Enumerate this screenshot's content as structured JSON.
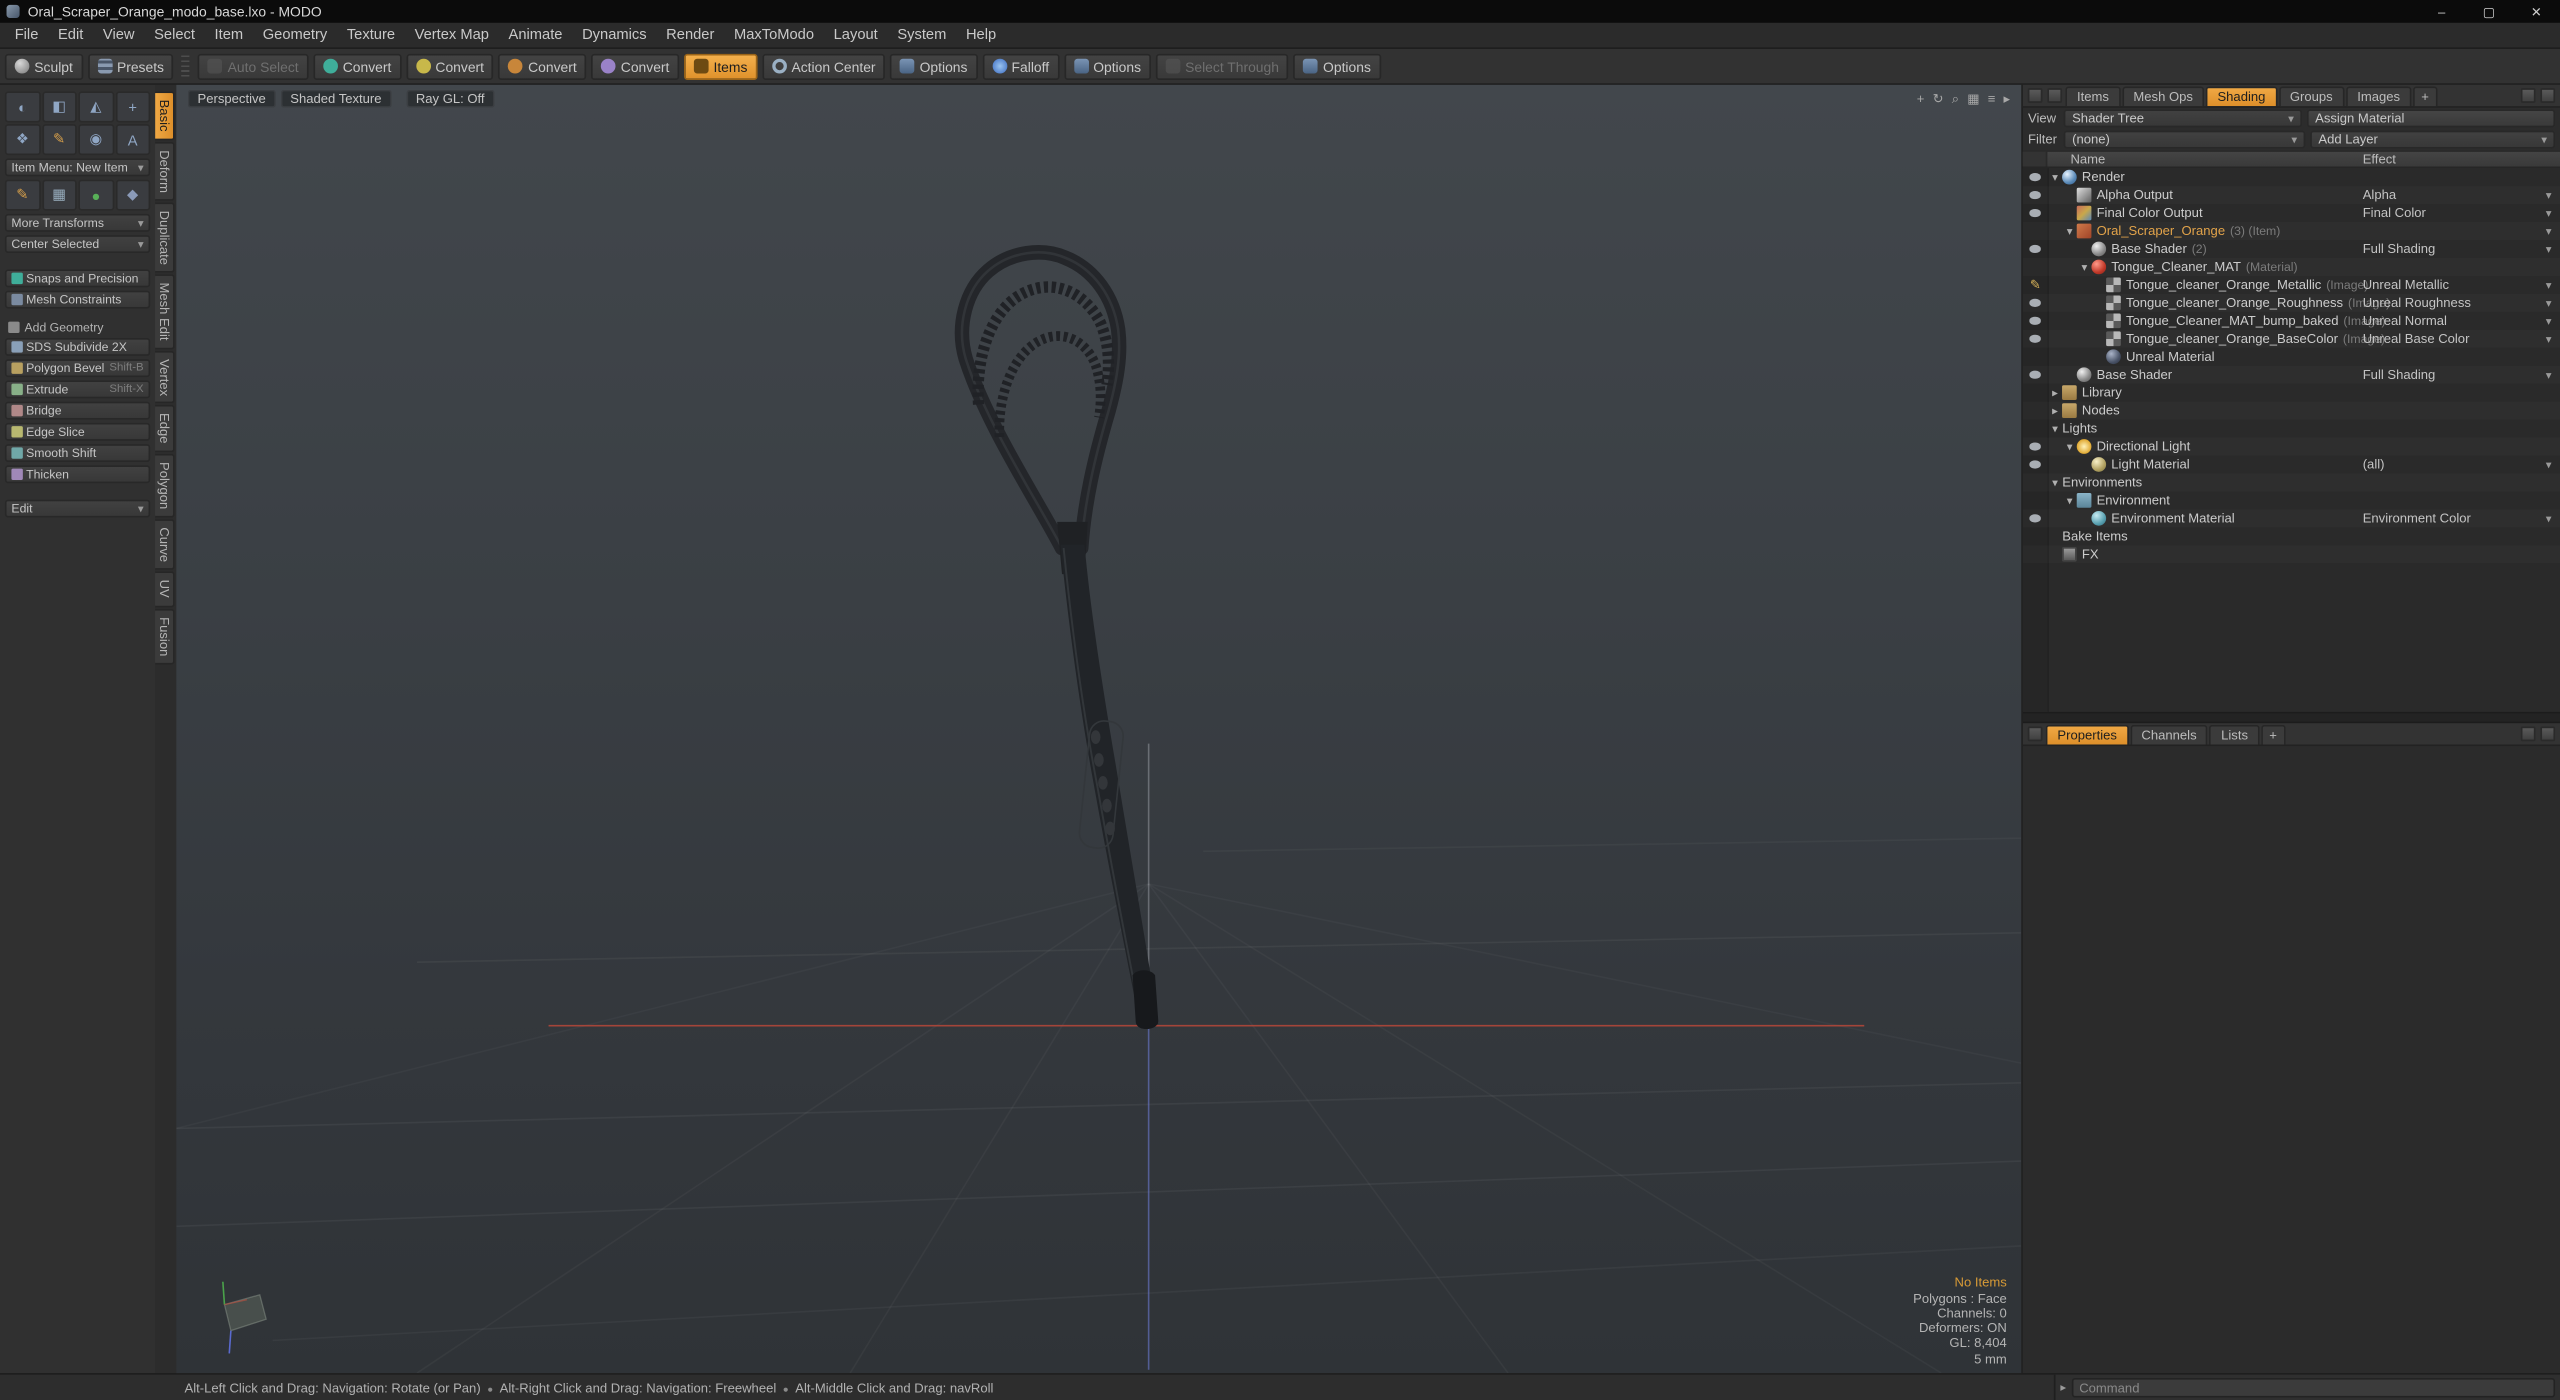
{
  "window": {
    "title": "Oral_Scraper_Orange_modo_base.lxo - MODO",
    "controls": {
      "minimize": "–",
      "maximize": "▢",
      "close": "✕"
    }
  },
  "menus": [
    "File",
    "Edit",
    "View",
    "Select",
    "Item",
    "Geometry",
    "Texture",
    "Vertex Map",
    "Animate",
    "Dynamics",
    "Render",
    "MaxToModo",
    "Layout",
    "System",
    "Help"
  ],
  "toolbar": [
    {
      "label": "Sculpt",
      "icon": "sculpt"
    },
    {
      "label": "Presets",
      "icon": "presets"
    },
    {
      "label": "Auto Select",
      "icon": "auto-select"
    },
    {
      "label": "Convert",
      "icon": "convert-vertex"
    },
    {
      "label": "Convert",
      "icon": "convert-edge"
    },
    {
      "label": "Convert",
      "icon": "convert-polygon"
    },
    {
      "label": "Convert",
      "icon": "convert-item"
    },
    {
      "label": "Items",
      "icon": "items"
    },
    {
      "label": "Action Center",
      "icon": "action-center"
    },
    {
      "label": "Options",
      "icon": "options-action"
    },
    {
      "label": "Falloff",
      "icon": "falloff"
    },
    {
      "label": "Options",
      "icon": "options-falloff"
    },
    {
      "label": "Select Through",
      "icon": "select-through"
    },
    {
      "label": "Options",
      "icon": "options-select"
    }
  ],
  "left_panel": {
    "tool_icons": [
      "brush",
      "flatten",
      "inflate",
      "move",
      "clone",
      "pencil",
      "eraser",
      "text"
    ],
    "item_menu": "Item Menu: New Item",
    "preset_icons": [
      "pencil",
      "grid",
      "sphere",
      "cube"
    ],
    "more_transforms": "More Transforms",
    "center_selected": "Center Selected",
    "toggles": [
      {
        "label": "Snaps and Precision",
        "icon": "snaps"
      },
      {
        "label": "Mesh Constraints",
        "icon": "constraints"
      }
    ],
    "section": {
      "label": "Add Geometry",
      "icon": "add-geometry"
    },
    "geometry_buttons": [
      {
        "label": "SDS Subdivide 2X",
        "shortcut": "",
        "icon": "subdivide"
      },
      {
        "label": "Polygon Bevel",
        "shortcut": "Shift-B",
        "icon": "bevel"
      },
      {
        "label": "Extrude",
        "shortcut": "Shift-X",
        "icon": "extrude"
      },
      {
        "label": "Bridge",
        "shortcut": "",
        "icon": "bridge"
      },
      {
        "label": "Edge Slice",
        "shortcut": "",
        "icon": "edge-slice"
      },
      {
        "label": "Smooth Shift",
        "shortcut": "",
        "icon": "smooth-shift"
      },
      {
        "label": "Thicken",
        "shortcut": "",
        "icon": "thicken"
      }
    ],
    "edit_label": "Edit",
    "side_tabs": [
      {
        "label": "Basic",
        "active": true
      },
      {
        "label": "Deform"
      },
      {
        "label": "Duplicate"
      },
      {
        "label": "Mesh Edit"
      },
      {
        "label": "Vertex"
      },
      {
        "label": "Edge"
      },
      {
        "label": "Polygon"
      },
      {
        "label": "Curve"
      },
      {
        "label": "UV"
      },
      {
        "label": "Fusion"
      }
    ]
  },
  "viewport": {
    "mode_buttons": [
      "Perspective",
      "Shaded Texture",
      "Ray GL: Off"
    ],
    "icons": [
      "target",
      "orbit",
      "zoom",
      "grid",
      "overlay",
      "expand"
    ],
    "info": {
      "no_items": "No Items",
      "lines": [
        "Polygons : Face",
        "Channels: 0",
        "Deformers: ON",
        "GL: 8,404",
        "5 mm"
      ]
    }
  },
  "shader_panel": {
    "tabs": [
      "Items",
      "Mesh Ops",
      "Shading",
      "Groups",
      "Images",
      "+"
    ],
    "active_tab": "Shading",
    "view_label": "View",
    "view_value": "Shader Tree",
    "assign_button": "Assign Material",
    "filter_label": "Filter",
    "filter_value": "(none)",
    "add_layer": "Add Layer",
    "columns": {
      "name": "Name",
      "effect": "Effect"
    },
    "rows": [
      {
        "name": "Render",
        "suffix": "",
        "effect": "",
        "level": 0,
        "icon": "render",
        "gutter": "eye",
        "arrow": "open",
        "dd": false,
        "sel": false
      },
      {
        "name": "Alpha Output",
        "suffix": "",
        "effect": "Alpha",
        "level": 1,
        "icon": "alpha-output",
        "gutter": "eye",
        "arrow": "",
        "dd": true,
        "sel": false
      },
      {
        "name": "Final Color Output",
        "suffix": "",
        "effect": "Final Color",
        "level": 1,
        "icon": "final-color",
        "gutter": "eye",
        "arrow": "",
        "dd": true,
        "sel": false
      },
      {
        "name": "Oral_Scraper_Orange",
        "suffix": "(3) (Item)",
        "effect": "",
        "level": 1,
        "icon": "mesh-item",
        "gutter": "",
        "arrow": "open",
        "dd": true,
        "sel": true
      },
      {
        "name": "Base Shader",
        "suffix": "(2)",
        "effect": "Full Shading",
        "level": 2,
        "icon": "shader",
        "gutter": "eye",
        "arrow": "",
        "dd": true,
        "sel": false
      },
      {
        "name": "Tongue_Cleaner_MAT",
        "suffix": "(Material)",
        "effect": "",
        "level": 2,
        "icon": "material",
        "gutter": "",
        "arrow": "open",
        "dd": false,
        "sel": false
      },
      {
        "name": "Tongue_cleaner_Orange_Metallic",
        "suffix": "(Image)",
        "effect": "Unreal Metallic",
        "level": 3,
        "icon": "image",
        "gutter": "brush",
        "arrow": "",
        "dd": true,
        "sel": false
      },
      {
        "name": "Tongue_cleaner_Orange_Roughness",
        "suffix": "(Image)",
        "effect": "Unreal Roughness",
        "level": 3,
        "icon": "image",
        "gutter": "eye",
        "arrow": "",
        "dd": true,
        "sel": false
      },
      {
        "name": "Tongue_Cleaner_MAT_bump_baked",
        "suffix": "(Image)",
        "effect": "Unreal Normal",
        "level": 3,
        "icon": "image",
        "gutter": "eye",
        "arrow": "",
        "dd": true,
        "sel": false
      },
      {
        "name": "Tongue_cleaner_Orange_BaseColor",
        "suffix": "(Image)",
        "effect": "Unreal Base Color",
        "level": 3,
        "icon": "image",
        "gutter": "eye",
        "arrow": "",
        "dd": true,
        "sel": false
      },
      {
        "name": "Unreal Material",
        "suffix": "",
        "effect": "",
        "level": 3,
        "icon": "unreal-material",
        "gutter": "",
        "arrow": "",
        "dd": false,
        "sel": false
      },
      {
        "name": "Base Shader",
        "suffix": "",
        "effect": "Full Shading",
        "level": 1,
        "icon": "shader",
        "gutter": "eye",
        "arrow": "",
        "dd": true,
        "sel": false
      },
      {
        "name": "Library",
        "suffix": "",
        "effect": "",
        "level": 0,
        "icon": "library",
        "gutter": "",
        "arrow": "closed",
        "dd": false,
        "sel": false
      },
      {
        "name": "Nodes",
        "suffix": "",
        "effect": "",
        "level": 0,
        "icon": "nodes",
        "gutter": "",
        "arrow": "closed",
        "dd": false,
        "sel": false
      },
      {
        "name": "Lights",
        "suffix": "",
        "effect": "",
        "level": 0,
        "icon": "",
        "gutter": "",
        "arrow": "open",
        "dd": false,
        "sel": false
      },
      {
        "name": "Directional Light",
        "suffix": "",
        "effect": "",
        "level": 1,
        "icon": "directional-light",
        "gutter": "eye",
        "arrow": "open",
        "dd": false,
        "sel": false
      },
      {
        "name": "Light Material",
        "suffix": "",
        "effect": "(all)",
        "level": 2,
        "icon": "light-material",
        "gutter": "eye",
        "arrow": "",
        "dd": true,
        "sel": false
      },
      {
        "name": "Environments",
        "suffix": "",
        "effect": "",
        "level": 0,
        "icon": "",
        "gutter": "",
        "arrow": "open",
        "dd": false,
        "sel": false
      },
      {
        "name": "Environment",
        "suffix": "",
        "effect": "",
        "level": 1,
        "icon": "environment",
        "gutter": "",
        "arrow": "open",
        "dd": false,
        "sel": false
      },
      {
        "name": "Environment Material",
        "suffix": "",
        "effect": "Environment Color",
        "level": 2,
        "icon": "environment-material",
        "gutter": "eye",
        "arrow": "",
        "dd": true,
        "sel": false
      },
      {
        "name": "Bake Items",
        "suffix": "",
        "effect": "",
        "level": 0,
        "icon": "",
        "gutter": "",
        "arrow": "",
        "dd": false,
        "sel": false
      },
      {
        "name": "FX",
        "suffix": "",
        "effect": "",
        "level": 0,
        "icon": "fx",
        "gutter": "",
        "arrow": "",
        "dd": false,
        "sel": false
      }
    ],
    "bottom_tabs": [
      "Properties",
      "Channels",
      "Lists",
      "+"
    ],
    "active_bottom_tab": "Properties",
    "command_placeholder": "Command"
  },
  "status_bar": {
    "hints": [
      "Alt-Left Click and Drag: Navigation: Rotate (or Pan)",
      "Alt-Right Click and Drag: Navigation: Freewheel",
      "Alt-Middle Click and Drag: navRoll"
    ]
  },
  "colors": {
    "accent_orange": "#e59a34",
    "axis_x_red": "#b84838",
    "axis_y_blue": "#6a7ad0",
    "viewport_top": "#42474c",
    "viewport_bottom": "#2f3337",
    "model_gray": "#212428",
    "info_orange": "#d79a36"
  }
}
